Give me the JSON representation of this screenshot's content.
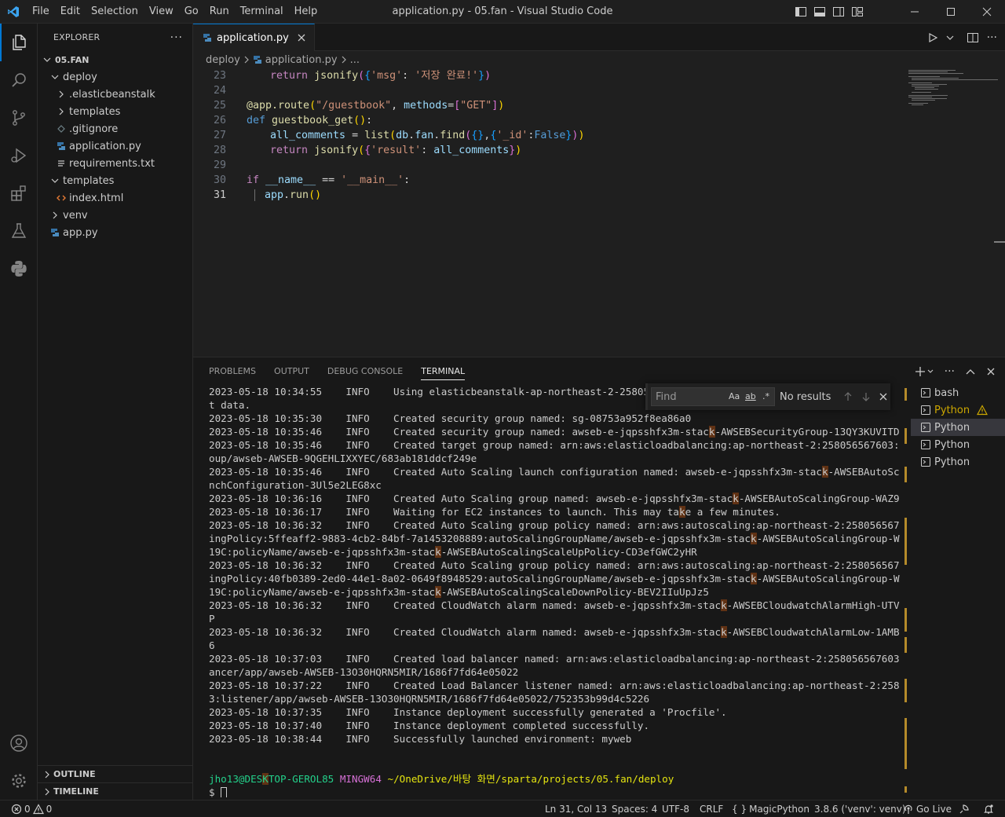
{
  "window": {
    "title": "application.py - 05.fan - Visual Studio Code"
  },
  "menu": [
    "File",
    "Edit",
    "Selection",
    "View",
    "Go",
    "Run",
    "Terminal",
    "Help"
  ],
  "sidebar": {
    "title": "EXPLORER",
    "more": "···",
    "tree": [
      {
        "label": "05.FAN",
        "type": "root"
      },
      {
        "label": "deploy",
        "type": "folder-open"
      },
      {
        "label": ".elasticbeanstalk",
        "type": "folder"
      },
      {
        "label": "templates",
        "type": "folder"
      },
      {
        "label": ".gitignore",
        "type": "file-git"
      },
      {
        "label": "application.py",
        "type": "file-py"
      },
      {
        "label": "requirements.txt",
        "type": "file-txt"
      },
      {
        "label": "templates",
        "type": "folder-open"
      },
      {
        "label": "index.html",
        "type": "file-html"
      },
      {
        "label": "venv",
        "type": "folder"
      },
      {
        "label": "app.py",
        "type": "file-py"
      }
    ],
    "outline": "OUTLINE",
    "timeline": "TIMELINE"
  },
  "editor": {
    "tab": "application.py",
    "breadcrumb": [
      "deploy",
      "application.py",
      "..."
    ],
    "line_numbers": [
      "23",
      "24",
      "25",
      "26",
      "27",
      "28",
      "29",
      "30",
      "31"
    ],
    "current_line": "31"
  },
  "panel": {
    "tabs": [
      "PROBLEMS",
      "OUTPUT",
      "DEBUG CONSOLE",
      "TERMINAL"
    ],
    "active_tab": "TERMINAL",
    "find": {
      "placeholder": "Find",
      "case": "Aa",
      "word": "ab",
      "regex": ".*",
      "result": "No results"
    },
    "terminal_lines": [
      "2023-05-18 10:34:55    INFO    Using elasticbeanstalk-ap-northeast-2-25805656760",
      "t data.",
      "2023-05-18 10:35:30    INFO    Created security group named: sg-08753a952f8ea86a0",
      "2023-05-18 10:35:46    INFO    Created security group named: awseb-e-jqpsshfx3m-stack-AWSEBSecurityGroup-13QY3KUVITDL9",
      "2023-05-18 10:35:46    INFO    Created target group named: arn:aws:elasticloadbalancing:ap-northeast-2:258056567603:targetgr",
      "oup/awseb-AWSEB-9QGEHLIXXYEC/683ab181ddcf249e",
      "2023-05-18 10:35:46    INFO    Created Auto Scaling launch configuration named: awseb-e-jqpsshfx3m-stack-AWSEBAutoScalingLau",
      "nchConfiguration-3Ul5e2LEG8xc",
      "2023-05-18 10:36:16    INFO    Created Auto Scaling group named: awseb-e-jqpsshfx3m-stack-AWSEBAutoScalingGroup-WAZ9D06YT19C",
      "2023-05-18 10:36:17    INFO    Waiting for EC2 instances to launch. This may take a few minutes.",
      "2023-05-18 10:36:32    INFO    Created Auto Scaling group policy named: arn:aws:autoscaling:ap-northeast-2:258056567603:scal",
      "ingPolicy:5ffeaff2-9883-4cb2-84bf-7a1453208889:autoScalingGroupName/awseb-e-jqpsshfx3m-stack-AWSEBAutoScalingGroup-WAZ9D06YT",
      "19C:policyName/awseb-e-jqpsshfx3m-stack-AWSEBAutoScalingScaleUpPolicy-CD3efGWC2yHR",
      "2023-05-18 10:36:32    INFO    Created Auto Scaling group policy named: arn:aws:autoscaling:ap-northeast-2:258056567603:scal",
      "ingPolicy:40fb0389-2ed0-44e1-8a02-0649f8948529:autoScalingGroupName/awseb-e-jqpsshfx3m-stack-AWSEBAutoScalingGroup-WAZ9D06YT",
      "19C:policyName/awseb-e-jqpsshfx3m-stack-AWSEBAutoScalingScaleDownPolicy-BEV2IIuUpJz5",
      "2023-05-18 10:36:32    INFO    Created CloudWatch alarm named: awseb-e-jqpsshfx3m-stack-AWSEBCloudwatchAlarmHigh-UTVFMOH7010",
      "P",
      "2023-05-18 10:36:32    INFO    Created CloudWatch alarm named: awseb-e-jqpsshfx3m-stack-AWSEBCloudwatchAlarmLow-1AMB8WP8PUPF",
      "6",
      "2023-05-18 10:37:03    INFO    Created load balancer named: arn:aws:elasticloadbalancing:ap-northeast-2:258056567603:loadbal",
      "ancer/app/awseb-AWSEB-13O30HQRN5MIR/1686f7fd64e05022",
      "2023-05-18 10:37:22    INFO    Created Load Balancer listener named: arn:aws:elasticloadbalancing:ap-northeast-2:25805656760",
      "3:listener/app/awseb-AWSEB-13O30HQRN5MIR/1686f7fd64e05022/752353b99d4c5226",
      "2023-05-18 10:37:35    INFO    Instance deployment successfully generated a 'Procfile'.",
      "2023-05-18 10:37:40    INFO    Instance deployment completed successfully.",
      "2023-05-18 10:38:44    INFO    Successfully launched environment: myweb"
    ],
    "prompt": {
      "user": "jho13@DESKTOP-GEROL85",
      "env": "MINGW64",
      "path": "~/OneDrive/바탕 화면/sparta/projects/05.fan/deploy",
      "symbol": "$"
    },
    "terminals": [
      "bash",
      "Python",
      "Python",
      "Python",
      "Python"
    ]
  },
  "status": {
    "errors": "0",
    "warnings": "0",
    "position": "Ln 31, Col 13",
    "spaces": "Spaces: 4",
    "encoding": "UTF-8",
    "eol": "CRLF",
    "language": "MagicPython",
    "interpreter": "3.8.6 ('venv': venv)",
    "live": "Go Live"
  },
  "colors": {
    "accent": "#0078d4",
    "warning": "#cca700",
    "highlight": "#613214"
  }
}
